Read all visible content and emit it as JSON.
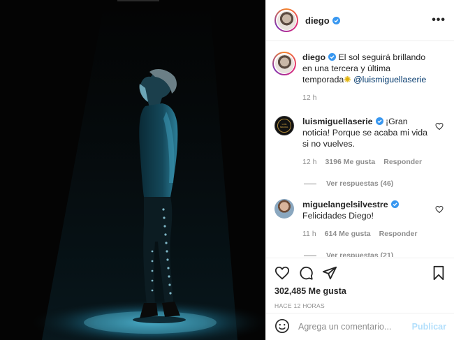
{
  "post": {
    "username": "diego",
    "caption_text": "El sol seguirá brillando en una tercera y última temporada",
    "caption_mention": "@luismiguellaserie",
    "caption_time": "12 h"
  },
  "comments": [
    {
      "username": "luismiguellaserie",
      "avatar_text": "LUIS MIGUEL",
      "text": "¡Gran noticia! Porque se acaba mi vida si no vuelves.",
      "time": "12 h",
      "likes": "3196 Me gusta",
      "reply": "Responder",
      "view_replies": "Ver respuestas (46)"
    },
    {
      "username": "miguelangelsilvestre",
      "text": "Felicidades Diego!",
      "time": "11 h",
      "likes": "614 Me gusta",
      "reply": "Responder",
      "view_replies": "Ver respuestas (21)"
    }
  ],
  "actions": {
    "likes_count": "302,485 Me gusta",
    "posted_ago": "HACE 12 HORAS"
  },
  "add_comment": {
    "placeholder": "Agrega un comentario...",
    "publish_label": "Publicar"
  },
  "icons": [
    "heart-icon",
    "comment-icon",
    "share-icon",
    "bookmark-icon",
    "emoji-icon",
    "more-icon",
    "verified-icon"
  ],
  "colors": {
    "verified": "#3897f0",
    "link": "#00376b",
    "muted": "#8e8e8e",
    "publish_disabled": "#b2dffc"
  }
}
